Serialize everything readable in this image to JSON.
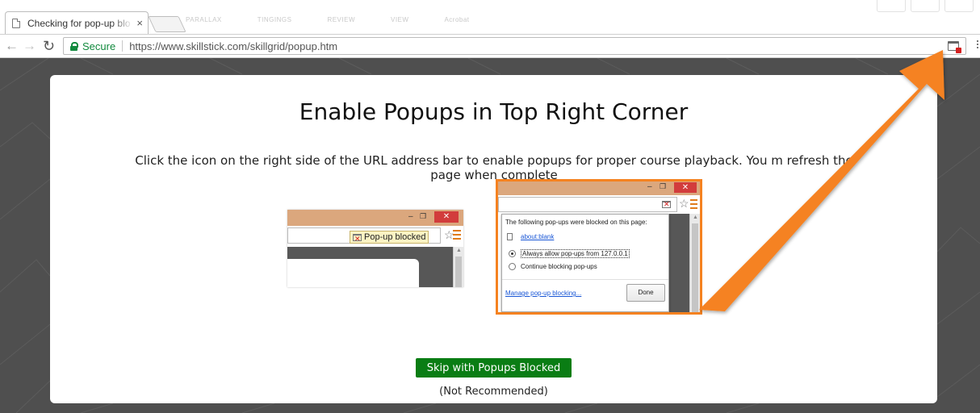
{
  "browser": {
    "tab_title": "Checking for pop-up blo",
    "tab_close": "×",
    "secure_label": "Secure",
    "url": "https://www.skillstick.com/skillgrid/popup.htm",
    "background_labels": [
      "PARALLAX",
      "TINGINGS",
      "REVIEW",
      "VIEW",
      "Acrobat"
    ]
  },
  "page": {
    "heading": "Enable Popups in Top Right Corner",
    "instructions": "Click the icon on the right side of the URL address bar to enable popups for proper course playback. You m refresh the page when complete",
    "example_small": {
      "minimize": "–",
      "maximize": "❐",
      "close": "✕",
      "popup_blocked_label": "Pop-up blocked",
      "star": "☆"
    },
    "example_large": {
      "minimize": "–",
      "maximize": "❐",
      "close": "✕",
      "star": "☆",
      "bubble_title": "The following pop-ups were blocked on this page:",
      "blocked_link": "about:blank",
      "option_allow": "Always allow pop-ups from 127.0.0.1",
      "option_block": "Continue blocking pop-ups",
      "manage_link": "Manage pop-up blocking...",
      "done_button": "Done"
    },
    "skip_button": "Skip with Popups Blocked",
    "not_recommended": "(Not Recommended)"
  },
  "colors": {
    "accent_arrow": "#f58220",
    "skip_button": "#0a7d14",
    "secure_green": "#128a3e",
    "link_blue": "#1a57d6"
  },
  "icons": [
    "page-icon",
    "back-arrow-icon",
    "forward-arrow-icon",
    "reload-icon",
    "lock-icon",
    "popup-blocked-icon",
    "star-icon",
    "menu-icon",
    "close-icon",
    "minimize-icon",
    "maximize-icon",
    "document-icon",
    "arrow-icon"
  ]
}
